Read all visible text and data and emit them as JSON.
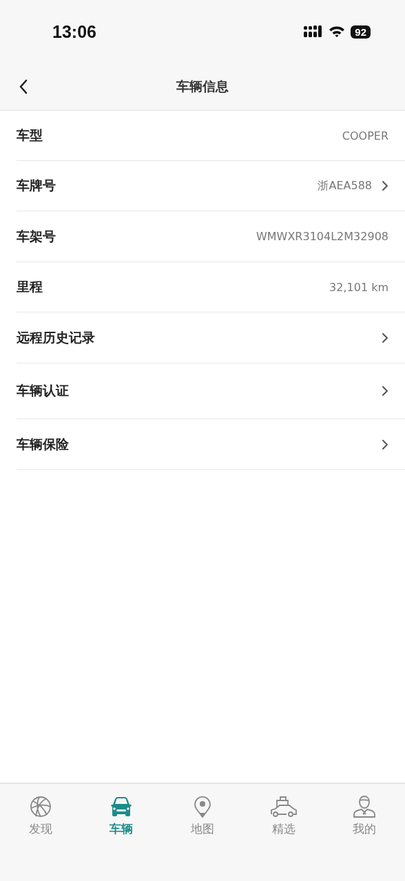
{
  "status_bar": {
    "time": "13:06",
    "battery": "92"
  },
  "header": {
    "title": "车辆信息"
  },
  "rows": [
    {
      "label": "车型",
      "value": "COOPER",
      "chevron": false
    },
    {
      "label": "车牌号",
      "value": "浙AEA588",
      "chevron": true
    },
    {
      "label": "车架号",
      "value": "WMWXR3104L2M32908",
      "chevron": false
    },
    {
      "label": "里程",
      "value": "32,101 km",
      "chevron": false
    },
    {
      "label": "远程历史记录",
      "chevron": true
    },
    {
      "label": "车辆认证",
      "chevron": true
    },
    {
      "label": "车辆保险",
      "chevron": true
    }
  ],
  "tab_bar": [
    {
      "label": "发现",
      "selected": false
    },
    {
      "label": "车辆",
      "selected": true
    },
    {
      "label": "地图",
      "selected": false
    },
    {
      "label": "精选",
      "selected": false
    },
    {
      "label": "我的",
      "selected": false
    }
  ]
}
